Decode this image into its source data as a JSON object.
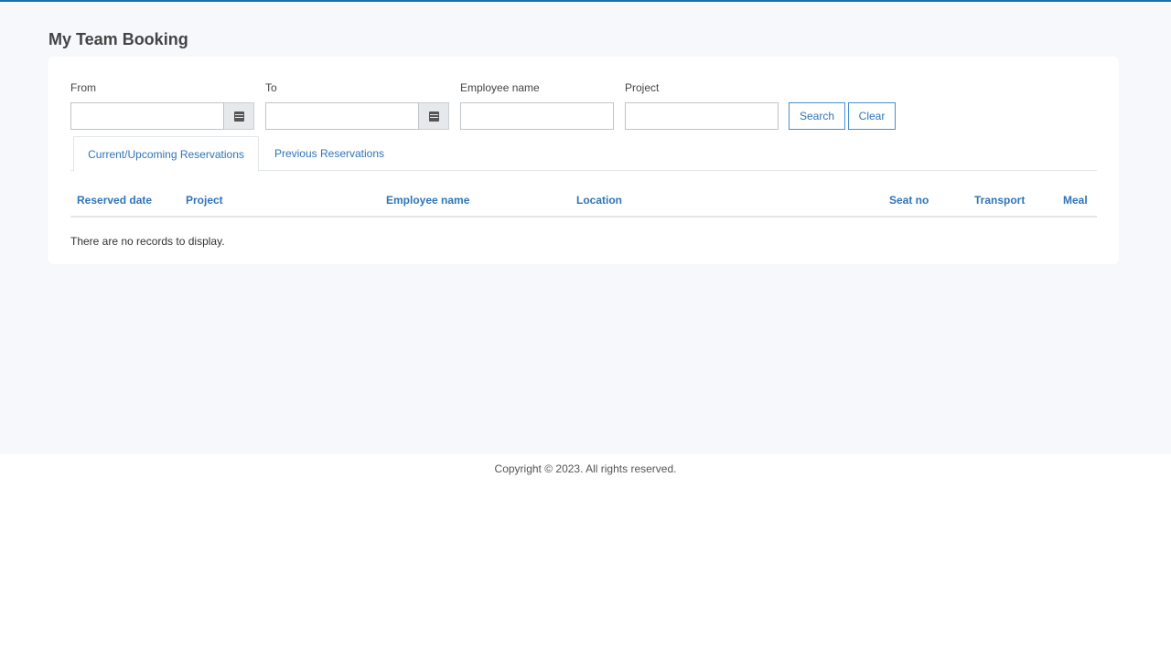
{
  "page": {
    "title": "My Team Booking"
  },
  "filters": {
    "from_label": "From",
    "to_label": "To",
    "employee_label": "Employee name",
    "project_label": "Project",
    "from_value": "",
    "to_value": "",
    "employee_value": "",
    "project_value": "",
    "search_label": "Search",
    "clear_label": "Clear"
  },
  "tabs": [
    {
      "label": "Current/Upcoming Reservations",
      "active": true
    },
    {
      "label": "Previous Reservations",
      "active": false
    }
  ],
  "table": {
    "columns": [
      "Reserved date",
      "Project",
      "Employee name",
      "Location",
      "Seat no",
      "Transport",
      "Meal"
    ],
    "empty_message": "There are no records to display."
  },
  "footer": {
    "copyright": "Copyright © 2023. All rights reserved."
  },
  "icons": {
    "calendar": "calendar-icon"
  },
  "colors": {
    "accent": "#2f74b8",
    "top_bar": "#1b6fb3",
    "page_background": "#f6f8fb"
  }
}
